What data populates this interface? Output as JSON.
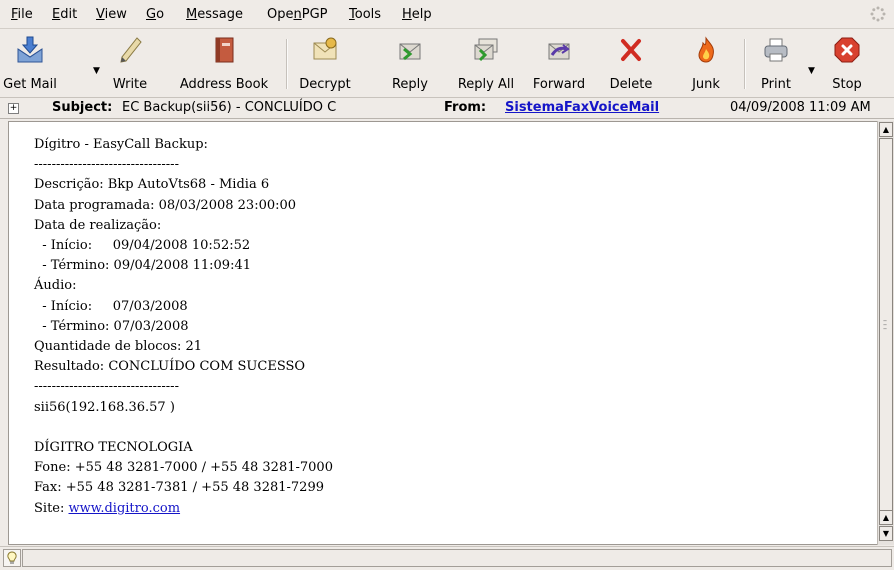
{
  "menu": [
    {
      "key": "file",
      "pre": "",
      "ul": "F",
      "post": "ile"
    },
    {
      "key": "edit",
      "pre": "",
      "ul": "E",
      "post": "dit"
    },
    {
      "key": "view",
      "pre": "",
      "ul": "V",
      "post": "iew"
    },
    {
      "key": "go",
      "pre": "",
      "ul": "G",
      "post": "o"
    },
    {
      "key": "message",
      "pre": "",
      "ul": "M",
      "post": "essage"
    },
    {
      "key": "openpgp",
      "pre": "Ope",
      "ul": "n",
      "post": "PGP"
    },
    {
      "key": "tools",
      "pre": "",
      "ul": "T",
      "post": "ools"
    },
    {
      "key": "help",
      "pre": "",
      "ul": "H",
      "post": "elp"
    }
  ],
  "toolbar": {
    "get_mail": "Get Mail",
    "write": "Write",
    "address_book": "Address Book",
    "decrypt": "Decrypt",
    "reply": "Reply",
    "reply_all": "Reply All",
    "forward": "Forward",
    "delete": "Delete",
    "junk": "Junk",
    "print": "Print",
    "stop": "Stop"
  },
  "header": {
    "subject_label": "Subject:",
    "subject": "EC Backup(sii56) - CONCLUÍDO C",
    "from_label": "From:",
    "from": "SistemaFaxVoiceMail",
    "date": "04/09/2008 11:09 AM"
  },
  "message": {
    "lines": [
      "Dígitro - EasyCall Backup:",
      "---------------------------------",
      "Descrição: Bkp AutoVts68 - Midia 6",
      "Data programada: 08/03/2008 23:00:00",
      "Data de realização:",
      "  - Início:     09/04/2008 10:52:52",
      "  - Término: 09/04/2008 11:09:41",
      "Áudio:",
      "  - Início:     07/03/2008",
      "  - Término: 07/03/2008",
      "Quantidade de blocos: 21",
      "Resultado: CONCLUÍDO COM SUCESSO",
      "---------------------------------",
      "sii56(192.168.36.57 )",
      "",
      "DÍGITRO TECNOLOGIA",
      "Fone: +55 48 3281-7000 / +55 48 3281-7000",
      "Fax: +55 48 3281-7381 / +55 48 3281-7299"
    ],
    "site_label": "Site: ",
    "site_link": "www.digitro.com"
  },
  "status": {
    "text": ""
  },
  "colors": {
    "link": "#1515c8",
    "background": "#efebe7"
  }
}
